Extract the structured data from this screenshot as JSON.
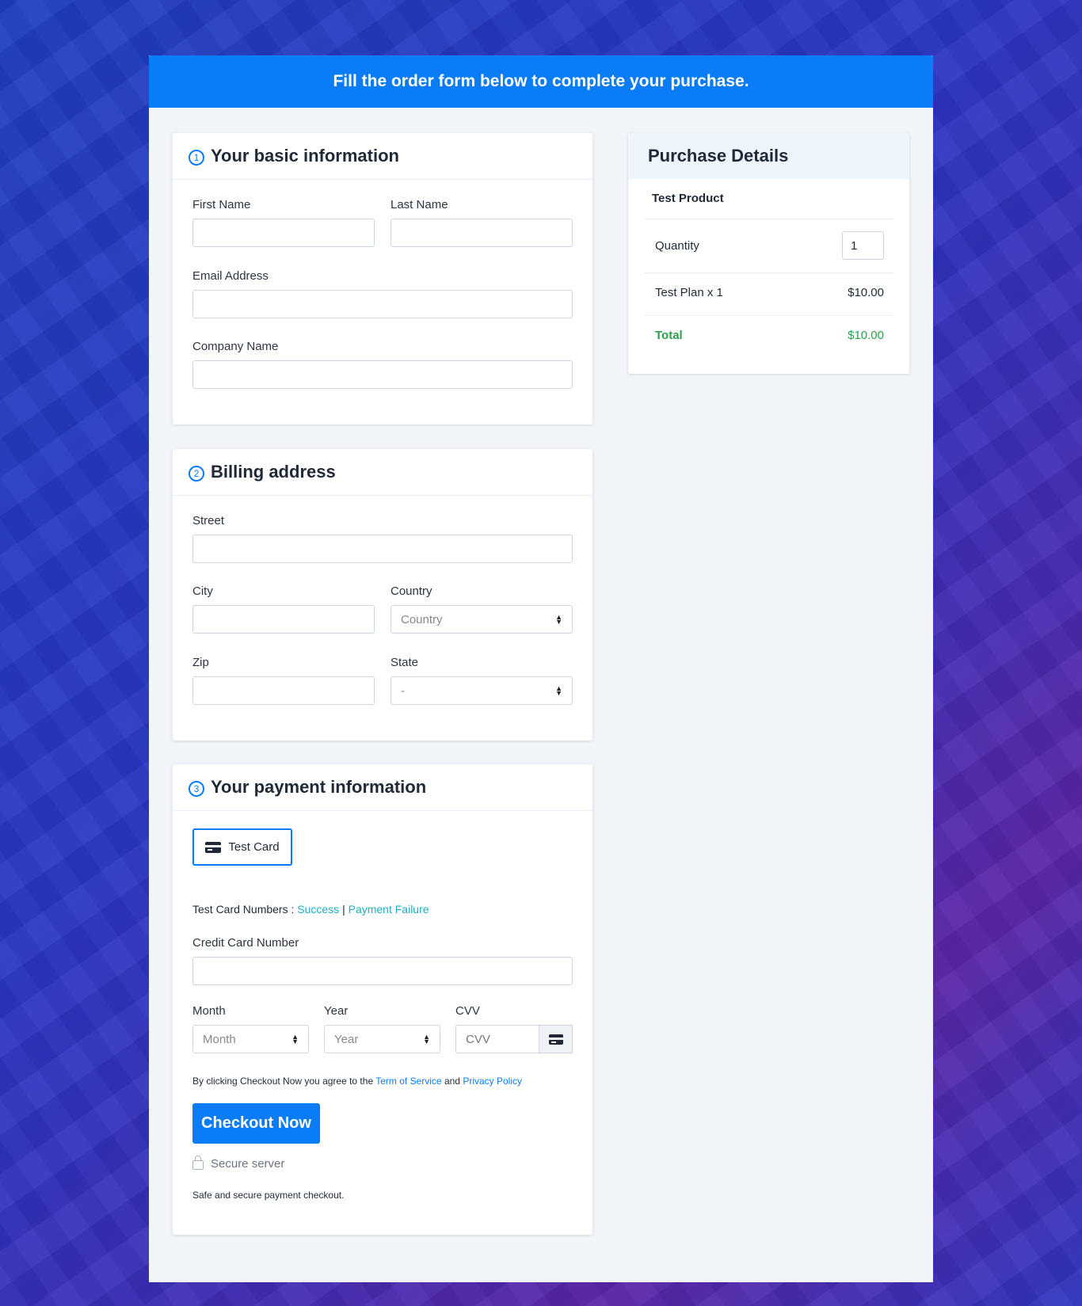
{
  "banner": {
    "title": "Fill the order form below to complete your purchase."
  },
  "basic_info": {
    "step": "1",
    "title": "Your basic information",
    "first_name_label": "First Name",
    "last_name_label": "Last Name",
    "email_label": "Email Address",
    "company_label": "Company Name"
  },
  "billing": {
    "step": "2",
    "title": "Billing address",
    "street_label": "Street",
    "city_label": "City",
    "country_label": "Country",
    "country_value": "Country",
    "zip_label": "Zip",
    "state_label": "State",
    "state_value": "-"
  },
  "payment": {
    "step": "3",
    "title": "Your payment information",
    "method_label": "Test Card",
    "test_numbers_label": "Test Card Numbers :",
    "success_link": "Success",
    "separator": "|",
    "failure_link": "Payment Failure",
    "cc_number_label": "Credit Card Number",
    "month_label": "Month",
    "month_value": "Month",
    "year_label": "Year",
    "year_value": "Year",
    "cvv_label": "CVV",
    "cvv_placeholder": "CVV",
    "terms_prefix": "By clicking Checkout Now you agree to the",
    "terms_link": "Term of Service",
    "terms_and": "and",
    "privacy_link": "Privacy Policy",
    "checkout_label": "Checkout Now",
    "secure_label": "Secure server",
    "safe_note": "Safe and secure payment checkout."
  },
  "purchase": {
    "title": "Purchase Details",
    "product": "Test Product",
    "quantity_label": "Quantity",
    "quantity_value": "1",
    "plan_label": "Test Plan x 1",
    "plan_price": "$10.00",
    "total_label": "Total",
    "total_value": "$10.00"
  },
  "colors": {
    "accent": "#0a7cf6",
    "total": "#2aa04a",
    "link_teal": "#1ab0c8"
  }
}
